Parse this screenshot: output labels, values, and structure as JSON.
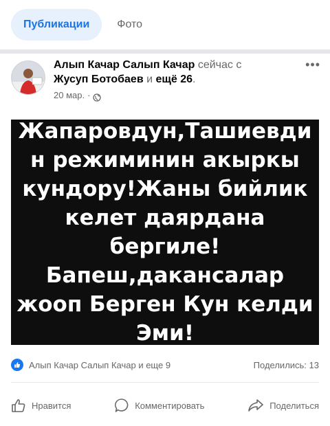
{
  "tabs": {
    "active_label": "Публикации",
    "other_label": "Фото"
  },
  "post": {
    "author": "Алып Качар Салып Качар",
    "status": "сейчас с",
    "with_person": "Жусуп Ботобаев",
    "and_word": "и",
    "more_people": "ещё 26",
    "dot": ".",
    "date": "20 мар.",
    "separator": "·",
    "privacy_icon": "globe-icon",
    "more_icon": "more-options-icon",
    "image_text": "Жапаровдун,Ташиевди\nн режиминин акыркы\nкундору!Жаны бийлик\nкелет даярдана\nбергиле!\nБапеш,дакансалар\nжооп Берген Кун келди\nЭми!"
  },
  "stats": {
    "reactors": "Алып Качар Салып Качар и еще 9",
    "shares": "Поделились: 13"
  },
  "actions": {
    "like_label": "Нравится",
    "comment_label": "Комментировать",
    "share_label": "Поделиться"
  },
  "colors": {
    "accent": "#1b74e4",
    "tab_active_bg": "#e7f0fd",
    "muted": "#65676b",
    "image_bg": "#0e0e0e"
  }
}
